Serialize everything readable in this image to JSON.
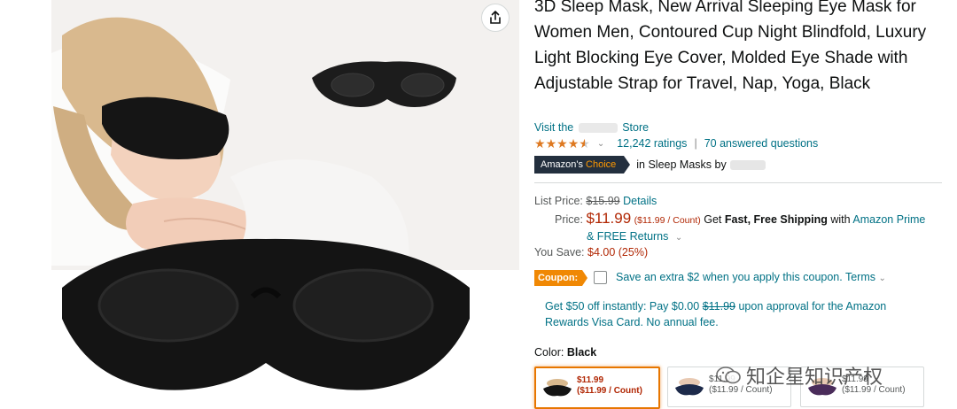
{
  "product": {
    "title": "3D Sleep Mask, New Arrival Sleeping Eye Mask for Women Men, Contoured Cup Night Blindfold, Luxury Light Blocking Eye Cover, Molded Eye Shade with Adjustable Strap for Travel, Nap, Yoga, Black",
    "store_prefix": "Visit the",
    "store_suffix": "Store",
    "ratings_count": "12,242 ratings",
    "answered_questions": "70 answered questions",
    "choice_badge_amazons": "Amazon's",
    "choice_badge_choice": "Choice",
    "choice_category": "in Sleep Masks by"
  },
  "pricing": {
    "list_price_label": "List Price:",
    "list_price": "$15.99",
    "details_link": "Details",
    "price_label": "Price:",
    "price": "$11.99",
    "unit_price": "($11.99 / Count)",
    "shipping_pre": "Get",
    "shipping_bold": "Fast, Free Shipping",
    "shipping_mid": "with",
    "prime_link": "Amazon Prime",
    "free_returns": "& FREE Returns",
    "you_save_label": "You Save:",
    "you_save": "$4.00 (25%)"
  },
  "coupon": {
    "badge": "Coupon:",
    "text": "Save an extra $2 when you apply this coupon. Terms"
  },
  "visa_offer": {
    "line1_pre": "Get $50 off instantly: Pay $0.00",
    "line1_strike": "$11.99",
    "line1_post": "upon approval for the Amazon",
    "line2": "Rewards Visa Card. No annual fee."
  },
  "color": {
    "label": "Color:",
    "value": "Black",
    "swatches": [
      {
        "price": "$11.99",
        "unit": "($11.99 / Count)"
      },
      {
        "price": "$11.99",
        "unit": "($11.99 / Count)"
      },
      {
        "price": "$11.99",
        "unit": "($11.99 / Count)"
      }
    ]
  },
  "watermark": "知企星知识产权",
  "icons": {
    "share": "share-icon",
    "stars": "star-rating-icon",
    "chevron": "chevron-down-icon"
  },
  "colors": {
    "link": "#007185",
    "price": "#b12704",
    "star": "#de7921",
    "badge_dark": "#232f3e",
    "coupon": "#f08804"
  },
  "rating_value": 4.5
}
